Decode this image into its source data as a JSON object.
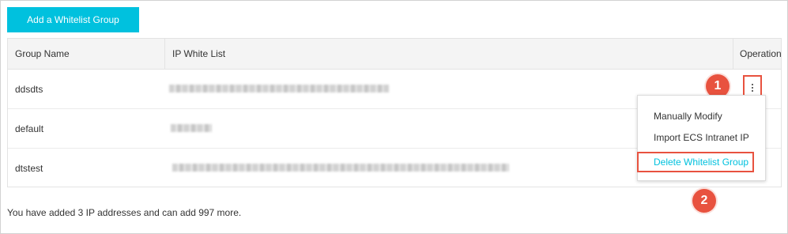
{
  "toolbar": {
    "add_label": "Add a Whitelist Group"
  },
  "table": {
    "headers": {
      "group_name": "Group Name",
      "ip_white_list": "IP White List",
      "operation": "Operation"
    },
    "rows": [
      {
        "group_name": "ddsdts"
      },
      {
        "group_name": "default"
      },
      {
        "group_name": "dtstest"
      }
    ]
  },
  "menu": {
    "items": [
      {
        "label": "Manually Modify"
      },
      {
        "label": "Import ECS Intranet IP"
      },
      {
        "label": "Delete Whitelist Group"
      }
    ]
  },
  "callouts": {
    "first": "1",
    "second": "2"
  },
  "footer": {
    "text": "You have added 3 IP addresses and can add 997 more."
  },
  "colors": {
    "accent": "#00c1de",
    "callout": "#e8523f"
  }
}
